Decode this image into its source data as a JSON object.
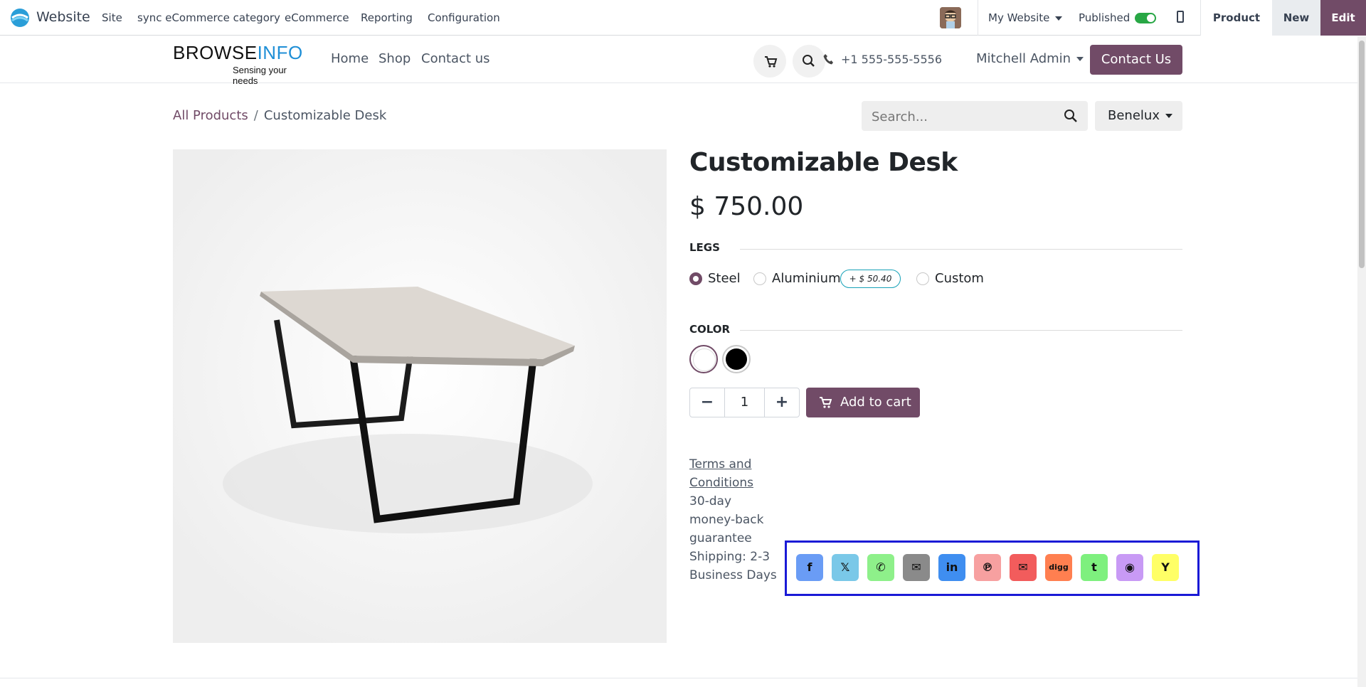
{
  "odoo_bar": {
    "app_name": "Website",
    "menus": [
      "Site",
      "sync eCommerce category",
      "eCommerce",
      "Reporting",
      "Configuration"
    ],
    "website_selector": "My Website",
    "published_label": "Published",
    "published": true,
    "product_label": "Product",
    "new_label": "New",
    "edit_label": "Edit"
  },
  "site_header": {
    "brand_main_1": "BROWSE",
    "brand_main_2": "INFO",
    "brand_tagline": "Sensing your needs",
    "nav": [
      "Home",
      "Shop",
      "Contact us"
    ],
    "phone": "+1 555-555-5556",
    "user": "Mitchell Admin",
    "contact_button": "Contact Us"
  },
  "breadcrumb": {
    "parent": "All Products",
    "current": "Customizable Desk"
  },
  "search": {
    "placeholder": "Search..."
  },
  "region": "Benelux",
  "product": {
    "name": "Customizable Desk",
    "price": "$ 750.00",
    "legs": {
      "heading": "LEGS",
      "options": [
        {
          "label": "Steel",
          "selected": true
        },
        {
          "label": "Aluminium",
          "selected": false,
          "extra": "+ $ 50.40"
        },
        {
          "label": "Custom",
          "selected": false
        }
      ]
    },
    "color": {
      "heading": "COLOR",
      "options": [
        {
          "name": "White",
          "hex": "#ffffff",
          "selected": true
        },
        {
          "name": "Black",
          "hex": "#000000",
          "selected": false
        }
      ]
    },
    "quantity": "1",
    "add_to_cart": "Add to cart",
    "terms_link": "Terms and Conditions",
    "terms_line1": "30-day money-back guarantee",
    "terms_line2": "Shipping: 2-3 Business Days"
  },
  "share": [
    {
      "name": "facebook",
      "icon": "f",
      "color": "#6a9cf5"
    },
    {
      "name": "x",
      "icon": "𝕏",
      "color": "#7ac8e8"
    },
    {
      "name": "whatsapp",
      "icon": "✆",
      "color": "#8ef08a"
    },
    {
      "name": "email",
      "icon": "✉",
      "color": "#8a8a8a"
    },
    {
      "name": "linkedin",
      "icon": "in",
      "color": "#3f8ef0"
    },
    {
      "name": "pinterest",
      "icon": "℗",
      "color": "#f7a0a0"
    },
    {
      "name": "mail",
      "icon": "✉",
      "color": "#f25c5c"
    },
    {
      "name": "digg",
      "icon": "digg",
      "color": "#ff7f50"
    },
    {
      "name": "tumblr",
      "icon": "t",
      "color": "#7ef07e"
    },
    {
      "name": "reddit",
      "icon": "◉",
      "color": "#c89af5"
    },
    {
      "name": "hackernews",
      "icon": "Y",
      "color": "#ffff66"
    }
  ],
  "colors": {
    "primary": "#714b67",
    "toggle_on": "#28a745",
    "highlight_border": "#1a1ad6"
  }
}
